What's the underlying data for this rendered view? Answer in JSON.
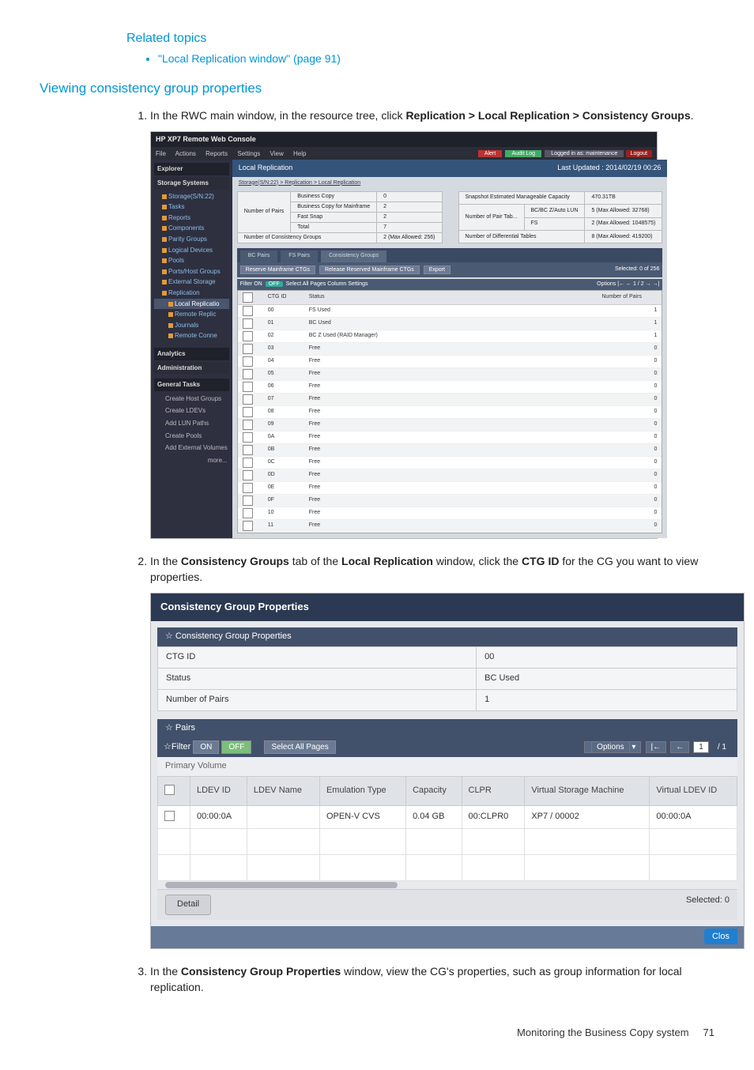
{
  "related": {
    "heading": "Related topics",
    "items": [
      "\"Local Replication window\" (page 91)"
    ]
  },
  "section": {
    "heading": "Viewing consistency group properties"
  },
  "steps": {
    "s1_pre": "In the RWC main window, in the resource tree, click ",
    "s1_b1": "Replication > Local Replication > Consistency Groups",
    "s2_pre": "In the ",
    "s2_b1": "Consistency Groups",
    "s2_mid1": " tab of the ",
    "s2_b2": "Local Replication",
    "s2_mid2": " window, click the ",
    "s2_b3": "CTG ID",
    "s2_post": " for the CG you want to view properties.",
    "s3_pre": "In the ",
    "s3_b1": "Consistency Group Properties",
    "s3_post": " window, view the CG's properties, such as group information for local replication."
  },
  "ss1": {
    "title": "HP XP7 Remote Web Console",
    "menus": [
      "File",
      "Actions",
      "Reports",
      "Settings",
      "View",
      "Help"
    ],
    "topright": {
      "alert": "Alert",
      "audit": "Audit Log",
      "logged": "Logged in as: maintenance",
      "logout": "Logout"
    },
    "content_header": "Local Replication",
    "last_updated": "Last Updated : 2014/02/19 00:26",
    "breadcrumb": "Storage(S/N:22) > Replication > Local Replication",
    "sidebar": {
      "explorer": "Explorer",
      "storage_systems": "Storage Systems",
      "tree": [
        "Storage(S/N:22)",
        "Tasks",
        "Reports",
        "Components",
        "Parity Groups",
        "Logical Devices",
        "Pools",
        "Ports/Host Groups",
        "External Storage",
        "Replication",
        "Local Replicatio",
        "Remote Replic",
        "Journals",
        "Remote Conne"
      ],
      "analytics": "Analytics",
      "admin": "Administration",
      "general_tasks": "General Tasks",
      "gt": [
        "Create Host Groups",
        "Create LDEVs",
        "Add LUN Paths",
        "Create Pools",
        "Add External Volumes",
        "more..."
      ]
    },
    "summary_left": {
      "r1k": "Number of Pairs",
      "r1a": "Business Copy",
      "r1v": "0",
      "r2a": "Business Copy for Mainframe",
      "r2v": "2",
      "r3a": "Fast Snap",
      "r3v": "2",
      "r4a": "Total",
      "r4v": "7",
      "r5k": "Number of Consistency Groups",
      "r5v": "2 (Max Allowed: 256)"
    },
    "summary_right": {
      "r1k": "Snapshot Estimated Manageable Capacity",
      "r1v": "470.31TB",
      "r2k": "Number of Pair Tab...",
      "r2a": "BC/BC Z/Auto LUN",
      "r2v": "5 (Max Allowed: 32768)",
      "r3a": "FS",
      "r3v": "2 (Max Allowed: 1048575)",
      "r4k": "Number of Differential Tables",
      "r4v": "8 (Max Allowed: 419200)"
    },
    "tabs": [
      "BC Pairs",
      "FS Pairs",
      "Consistency Groups"
    ],
    "btns": {
      "b1": "Reserve Mainframe CTGs",
      "b2": "Release Reserved Mainframe CTGs",
      "b3": "Export",
      "selected": "Selected: 0  of 256"
    },
    "filter": {
      "lbl": "Filter",
      "on": "ON",
      "off": "OFF",
      "sel": "Select All Pages",
      "col": "Column Settings",
      "options": "Options",
      "page": "1",
      "of": "/ 2"
    },
    "grid": {
      "cols": [
        "",
        "CTG ID",
        "Status",
        "Number of Pairs"
      ],
      "rows": [
        {
          "id": "00",
          "status": "FS Used",
          "n": "1"
        },
        {
          "id": "01",
          "status": "BC Used",
          "n": "1"
        },
        {
          "id": "02",
          "status": "BC Z Used (RAID Manager)",
          "n": "1"
        },
        {
          "id": "03",
          "status": "Free",
          "n": "0"
        },
        {
          "id": "04",
          "status": "Free",
          "n": "0"
        },
        {
          "id": "05",
          "status": "Free",
          "n": "0"
        },
        {
          "id": "06",
          "status": "Free",
          "n": "0"
        },
        {
          "id": "07",
          "status": "Free",
          "n": "0"
        },
        {
          "id": "08",
          "status": "Free",
          "n": "0"
        },
        {
          "id": "09",
          "status": "Free",
          "n": "0"
        },
        {
          "id": "0A",
          "status": "Free",
          "n": "0"
        },
        {
          "id": "0B",
          "status": "Free",
          "n": "0"
        },
        {
          "id": "0C",
          "status": "Free",
          "n": "0"
        },
        {
          "id": "0D",
          "status": "Free",
          "n": "0"
        },
        {
          "id": "0E",
          "status": "Free",
          "n": "0"
        },
        {
          "id": "0F",
          "status": "Free",
          "n": "0"
        },
        {
          "id": "10",
          "status": "Free",
          "n": "0"
        },
        {
          "id": "11",
          "status": "Free",
          "n": "0"
        }
      ]
    }
  },
  "ss2": {
    "title": "Consistency Group Properties",
    "prop_section": "Consistency Group Properties",
    "props": {
      "k1": "CTG ID",
      "v1": "00",
      "k2": "Status",
      "v2": "BC Used",
      "k3": "Number of Pairs",
      "v3": "1"
    },
    "pairs_section": "Pairs",
    "filter": {
      "lbl": "Filter",
      "on": "ON",
      "off": "OFF",
      "sel": "Select All Pages",
      "options": "Options",
      "page": "1",
      "of": "/ 1"
    },
    "group_header": "Primary Volume",
    "cols": [
      "",
      "LDEV ID",
      "LDEV Name",
      "Emulation Type",
      "Capacity",
      "CLPR",
      "Virtual Storage Machine",
      "Virtual LDEV ID"
    ],
    "row": {
      "ldev": "00:00:0A",
      "name": "",
      "emul": "OPEN-V CVS",
      "cap": "0.04 GB",
      "clpr": "00:CLPR0",
      "vsm": "XP7 / 00002",
      "vldev": "00:00:0A"
    },
    "detail": "Detail",
    "selected": "Selected: 0",
    "close": "Clos"
  },
  "footer": {
    "text": "Monitoring the Business Copy system",
    "page": "71"
  }
}
